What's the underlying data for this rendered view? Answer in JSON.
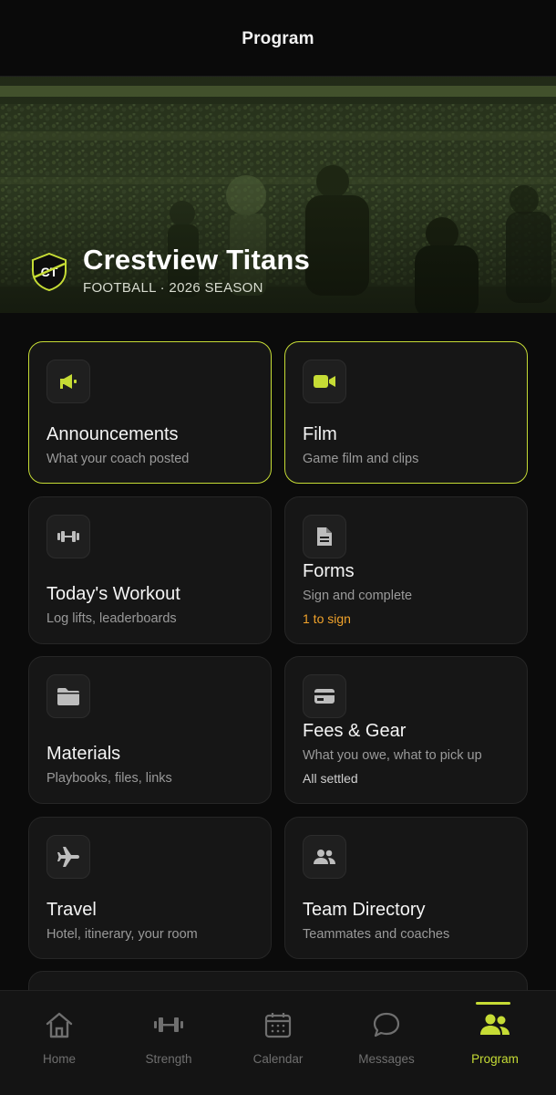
{
  "header": {
    "title": "Program"
  },
  "team": {
    "initials": "CT",
    "name": "Crestview Titans",
    "subtitle": "FOOTBALL · 2026 SEASON"
  },
  "colors": {
    "accent": "#c6dc35",
    "warning": "#f0a22b",
    "card_bg": "#161616",
    "page_bg": "#0b0b0b"
  },
  "cards": [
    {
      "title": "Announcements",
      "subtitle": "What your coach posted",
      "icon": "megaphone-icon",
      "highlighted": true
    },
    {
      "title": "Film",
      "subtitle": "Game film and clips",
      "icon": "video-camera-icon",
      "highlighted": true
    },
    {
      "title": "Today's Workout",
      "subtitle": "Log lifts, leaderboards",
      "icon": "dumbbell-icon",
      "highlighted": false
    },
    {
      "title": "Forms",
      "subtitle": "Sign and complete",
      "note": "1 to sign",
      "icon": "document-icon",
      "highlighted": false
    },
    {
      "title": "Materials",
      "subtitle": "Playbooks, files, links",
      "icon": "folder-icon",
      "highlighted": false
    },
    {
      "title": "Fees & Gear",
      "subtitle": "What you owe, what to pick up",
      "note": "All settled",
      "icon": "credit-card-icon",
      "highlighted": false
    },
    {
      "title": "Travel",
      "subtitle": "Hotel, itinerary, your room",
      "icon": "airplane-icon",
      "highlighted": false
    },
    {
      "title": "Team Directory",
      "subtitle": "Teammates and coaches",
      "icon": "people-icon",
      "highlighted": false
    }
  ],
  "tabs": [
    {
      "label": "Home",
      "icon": "home-icon"
    },
    {
      "label": "Strength",
      "icon": "dumbbell-icon"
    },
    {
      "label": "Calendar",
      "icon": "calendar-icon"
    },
    {
      "label": "Messages",
      "icon": "chat-bubble-icon"
    },
    {
      "label": "Program",
      "icon": "people-icon",
      "active": true
    }
  ]
}
